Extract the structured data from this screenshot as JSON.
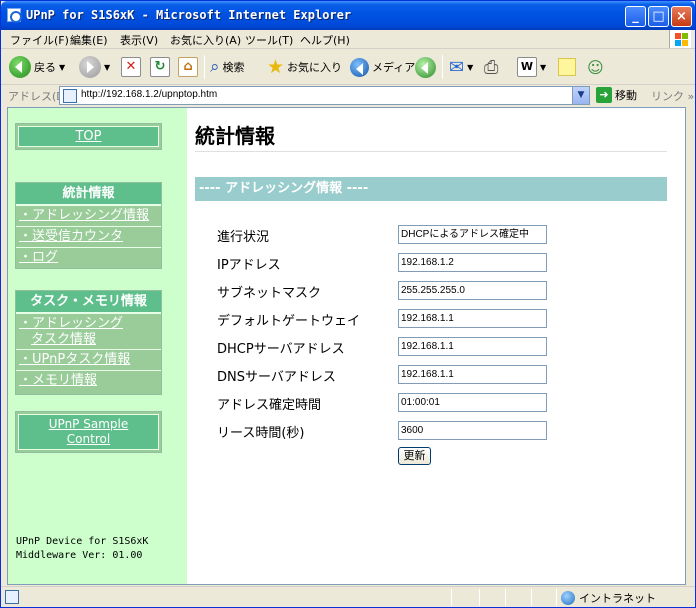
{
  "window": {
    "title": "UPnP for S1S6xK - Microsoft Internet Explorer"
  },
  "menu": [
    "ファイル(F)",
    "編集(E)",
    "表示(V)",
    "お気に入り(A)",
    "ツール(T)",
    "ヘルプ(H)"
  ],
  "toolbar": {
    "back": "戻る",
    "search": "検索",
    "favorites": "お気に入り",
    "media": "メディア"
  },
  "address": {
    "label": "アドレス(D)",
    "url": "http://192.168.1.2/upnptop.htm",
    "go": "移動",
    "links": "リンク"
  },
  "sidebar": {
    "top": "TOP",
    "stats_header": "統計情報",
    "stats_items": [
      "・アドレッシング情報",
      "・送受信カウンタ",
      "・ログ"
    ],
    "task_header": "タスク・メモリ情報",
    "task_items": [
      "・アドレッシング",
      "タスク情報",
      "・UPnPタスク情報",
      "・メモリ情報"
    ],
    "sample_line1": "UPnP Sample",
    "sample_line2": "Control",
    "footer_line1": "UPnP Device for S1S6xK",
    "footer_line2": "Middleware Ver: 01.00"
  },
  "main": {
    "title": "統計情報",
    "section": "---- アドレッシング情報 ----",
    "rows": [
      {
        "label": "進行状況",
        "value": "DHCPによるアドレス確定中"
      },
      {
        "label": "IPアドレス",
        "value": "192.168.1.2"
      },
      {
        "label": "サブネットマスク",
        "value": "255.255.255.0"
      },
      {
        "label": "デフォルトゲートウェイ",
        "value": "192.168.1.1"
      },
      {
        "label": "DHCPサーバアドレス",
        "value": "192.168.1.1"
      },
      {
        "label": "DNSサーバアドレス",
        "value": "192.168.1.1"
      },
      {
        "label": "アドレス確定時間",
        "value": "01:00:01"
      },
      {
        "label": "リース時間(秒)",
        "value": "3600"
      }
    ],
    "update_button": "更新"
  },
  "status": {
    "zone": "イントラネット"
  },
  "colors": {
    "sidebar_bg": "#ccffcc",
    "sidebar_box": "#99cc99",
    "section_bar": "#99cccc",
    "title_bar": "#0054e3"
  }
}
